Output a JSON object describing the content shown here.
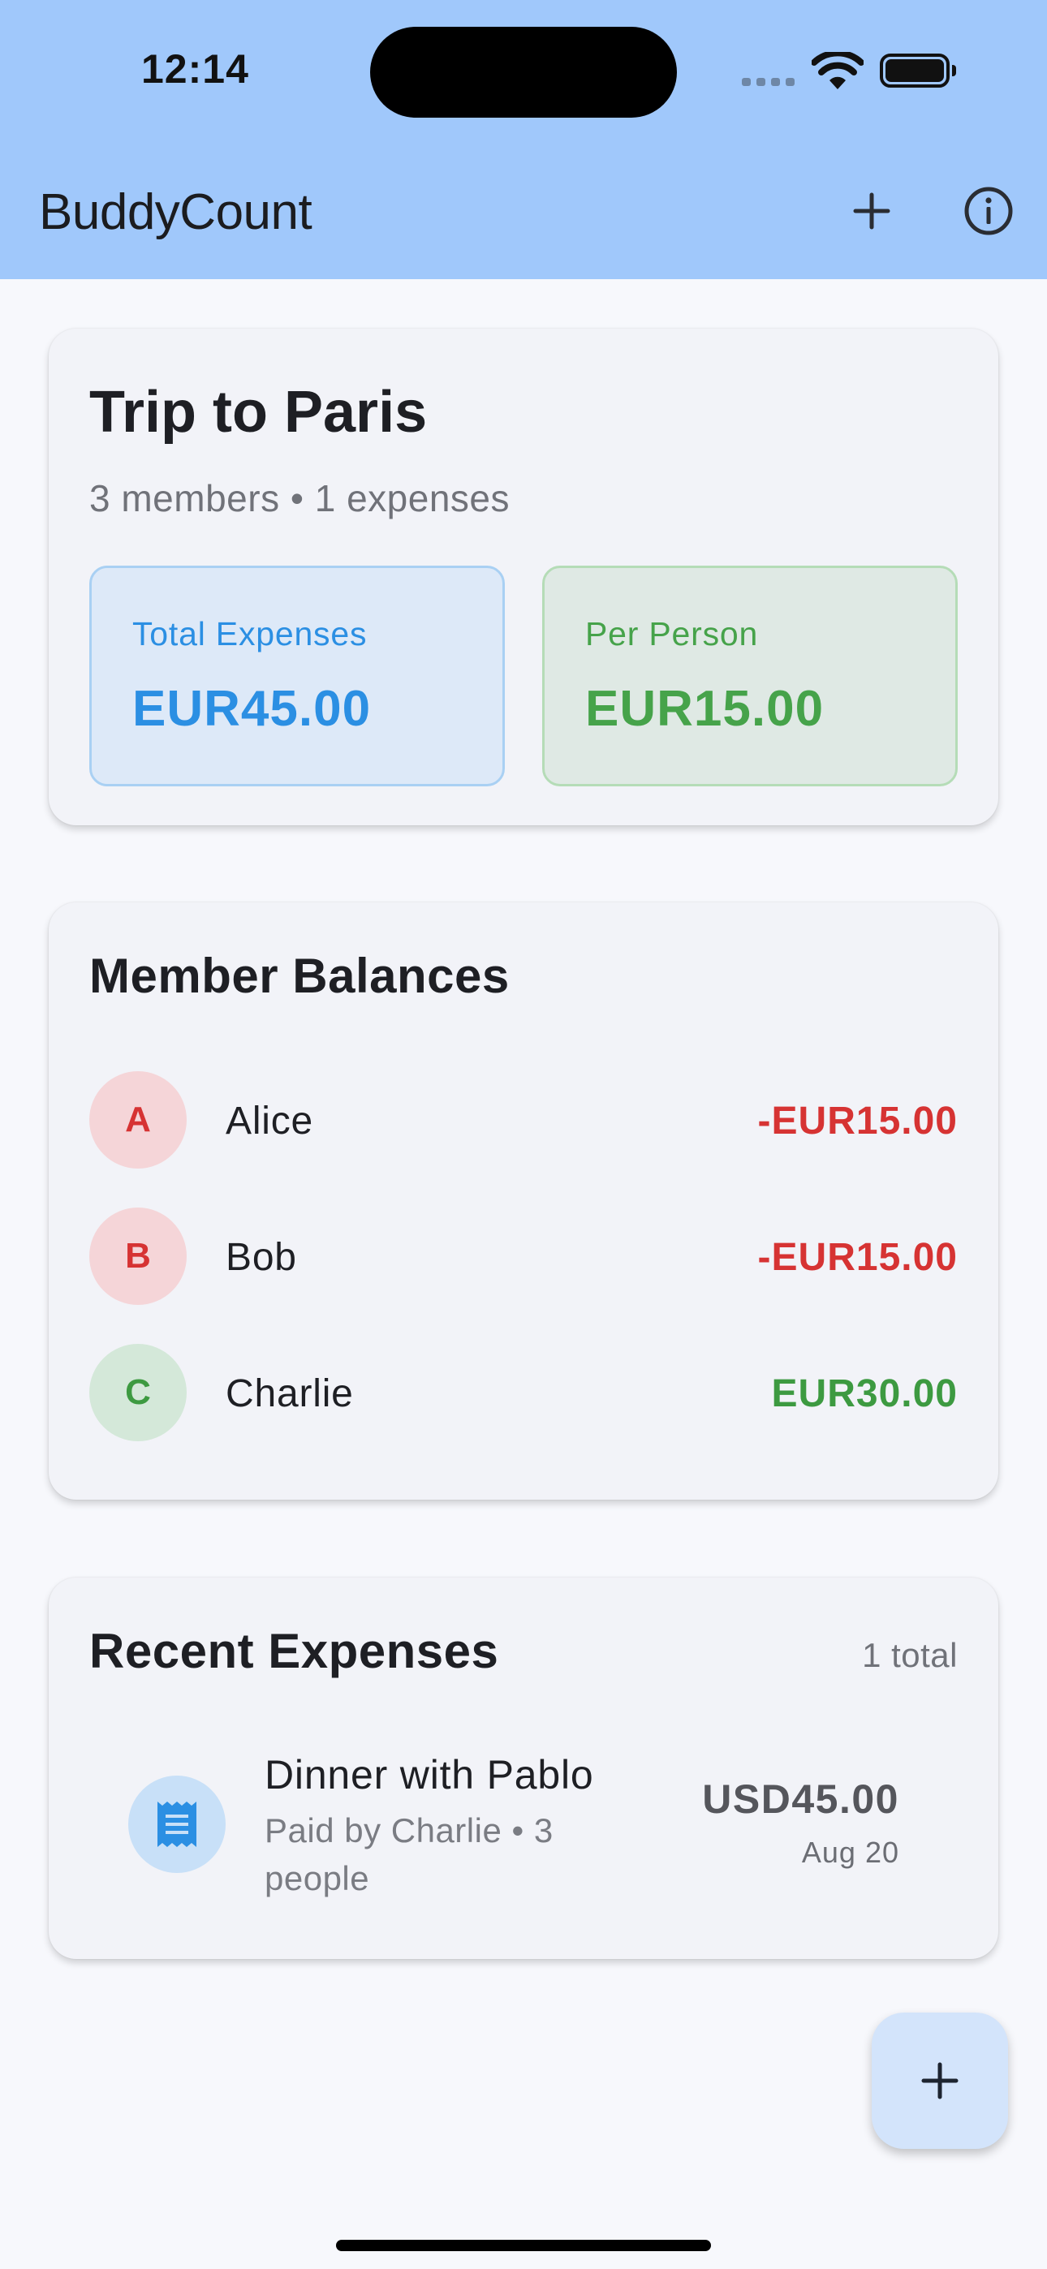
{
  "status_bar": {
    "time": "12:14"
  },
  "app_bar": {
    "title": "BuddyCount",
    "actions": [
      {
        "icon": "plus-icon"
      },
      {
        "icon": "info-icon"
      }
    ]
  },
  "group": {
    "name": "Trip to Paris",
    "meta": "3 members • 1 expenses",
    "stats": {
      "total_label": "Total Expenses",
      "total_value": "EUR45.00",
      "per_person_label": "Per Person",
      "per_person_value": "EUR15.00"
    }
  },
  "balances": {
    "title": "Member Balances",
    "members": [
      {
        "initial": "A",
        "name": "Alice",
        "balance": "-EUR15.00",
        "status": "negative"
      },
      {
        "initial": "B",
        "name": "Bob",
        "balance": "-EUR15.00",
        "status": "negative"
      },
      {
        "initial": "C",
        "name": "Charlie",
        "balance": "EUR30.00",
        "status": "positive"
      }
    ]
  },
  "expenses": {
    "title": "Recent Expenses",
    "count": "1 total",
    "items": [
      {
        "icon": "receipt-icon",
        "title": "Dinner with Pablo",
        "subtitle": "Paid by Charlie • 3 people",
        "amount": "USD45.00",
        "date": "Aug 20"
      }
    ]
  },
  "fab": {
    "icon": "plus-icon"
  },
  "colors": {
    "app_bar": "#a0c8fb",
    "accent_blue": "#2b8fe3",
    "accent_green": "#46a34a",
    "negative": "#d63333",
    "positive": "#3d9a41",
    "negative_avatar_bg": "#f5d5d8",
    "positive_avatar_bg": "#d4e8d9"
  }
}
